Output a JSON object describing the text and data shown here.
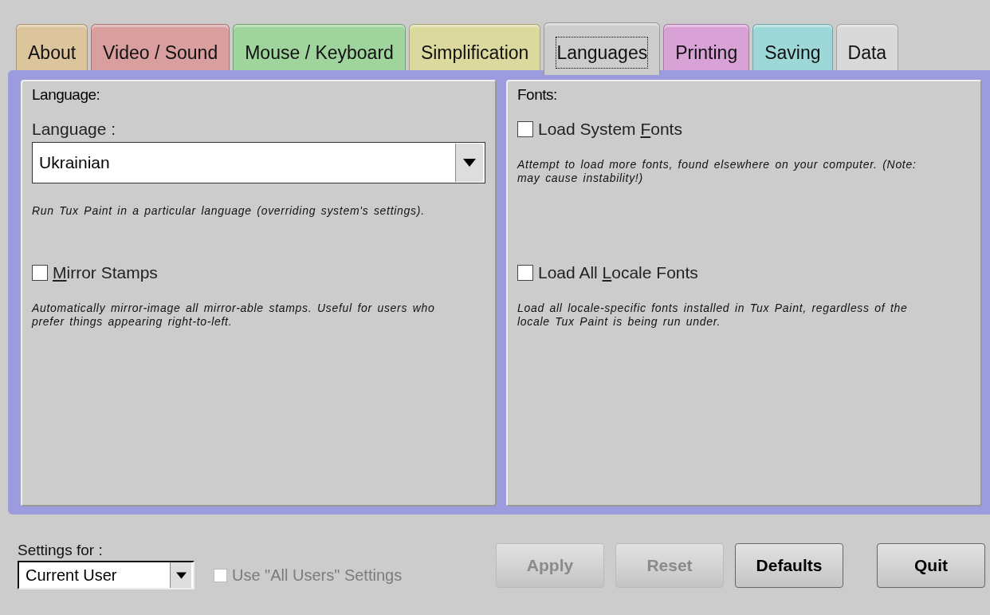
{
  "tabs": [
    {
      "label": "About",
      "selected": false,
      "color": "#dcc49c"
    },
    {
      "label": "Video / Sound",
      "selected": false,
      "color": "#d99e9e"
    },
    {
      "label": "Mouse / Keyboard",
      "selected": false,
      "color": "#9fd59c"
    },
    {
      "label": "Simplification",
      "selected": false,
      "color": "#dcd99e"
    },
    {
      "label": "Languages",
      "selected": true,
      "color": "#cccccc"
    },
    {
      "label": "Printing",
      "selected": false,
      "color": "#d9a2d6"
    },
    {
      "label": "Saving",
      "selected": false,
      "color": "#9dd7d7"
    },
    {
      "label": "Data",
      "selected": false,
      "color": "#d9d9d9"
    }
  ],
  "panels": [
    {
      "title": "Language:",
      "items": [
        {
          "kind": "dropdown",
          "label": "Language :",
          "value": "Ukrainian",
          "description": "Run Tux Paint in a particular language (overriding system's settings)."
        },
        {
          "kind": "checkbox",
          "label_parts": [
            {
              "text": "M",
              "underline": true
            },
            {
              "text": "irror Stamps",
              "underline": false
            }
          ],
          "checked": false,
          "description": "Automatically mirror-image all mirror-able stamps. Useful for users who prefer things appearing right-to-left."
        }
      ]
    },
    {
      "title": "Fonts:",
      "items": [
        {
          "kind": "checkbox",
          "label_parts": [
            {
              "text": "Load System ",
              "underline": false
            },
            {
              "text": "F",
              "underline": true
            },
            {
              "text": "onts",
              "underline": false
            }
          ],
          "checked": false,
          "description": "Attempt to load more fonts, found elsewhere on your computer. (Note: may cause instability!)"
        },
        {
          "kind": "checkbox",
          "label_parts": [
            {
              "text": "Load All ",
              "underline": false
            },
            {
              "text": "L",
              "underline": true
            },
            {
              "text": "ocale Fonts",
              "underline": false
            }
          ],
          "checked": false,
          "description": "Load all locale-specific fonts installed in Tux Paint, regardless of the locale Tux Paint is being run under."
        }
      ]
    }
  ],
  "footer": {
    "settings_label": "Settings for :",
    "settings_value": "Current User",
    "all_users": {
      "label": "Use \"All Users\" Settings",
      "checked": false,
      "disabled": true
    },
    "buttons": [
      {
        "label": "Apply",
        "disabled": true
      },
      {
        "label": "Reset",
        "disabled": true
      },
      {
        "label": "Defaults",
        "disabled": false
      },
      {
        "label": "Quit",
        "disabled": false
      }
    ]
  }
}
